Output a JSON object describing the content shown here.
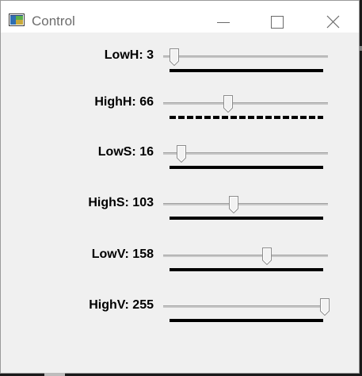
{
  "window": {
    "title": "Control",
    "icon": "opencv-window-icon",
    "buttons": [
      "minimize-icon",
      "maximize-icon",
      "close-icon"
    ]
  },
  "trackbars": [
    {
      "label": "LowH: 3",
      "value": 3,
      "max": 179,
      "dashed": false
    },
    {
      "label": "HighH: 66",
      "value": 66,
      "max": 179,
      "dashed": true
    },
    {
      "label": "LowS: 16",
      "value": 16,
      "max": 255,
      "dashed": false
    },
    {
      "label": "HighS: 103",
      "value": 103,
      "max": 255,
      "dashed": false
    },
    {
      "label": "LowV: 158",
      "value": 158,
      "max": 255,
      "dashed": false
    },
    {
      "label": "HighV: 255",
      "value": 255,
      "max": 255,
      "dashed": false
    }
  ],
  "colors": {
    "window_bg": "#f0f0f0",
    "titlebar_bg": "#ffffff",
    "title_text": "#6d6d6d",
    "label_text": "#000000"
  }
}
